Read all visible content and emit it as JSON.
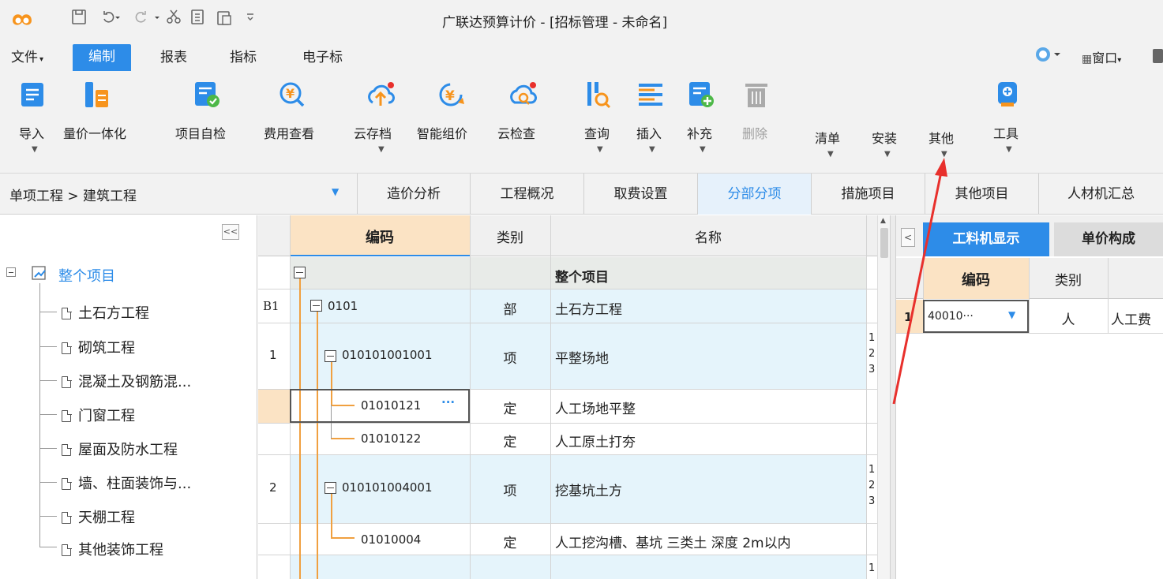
{
  "title": "广联达预算计价 - [招标管理 - 未命名]",
  "menu": {
    "file": "文件",
    "tabs": [
      "编制",
      "报表",
      "指标",
      "电子标"
    ],
    "window_label": "窗口"
  },
  "ribbon": {
    "buttons": [
      "导入",
      "量价一体化",
      "项目自检",
      "费用查看",
      "云存档",
      "智能组价",
      "云检查",
      "查询",
      "插入",
      "补充",
      "删除",
      "清单",
      "安装",
      "其他",
      "工具"
    ]
  },
  "nav": {
    "breadcrumb": "单项工程 > 建筑工程",
    "tabs": [
      "造价分析",
      "工程概况",
      "取费设置",
      "分部分项",
      "措施项目",
      "其他项目",
      "人材机汇总"
    ],
    "active_tab": "分部分项"
  },
  "tree": {
    "collapse_glyph": "<<",
    "root": "整个项目",
    "items": [
      "土石方工程",
      "砌筑工程",
      "混凝土及钢筋混...",
      "门窗工程",
      "屋面及防水工程",
      "墙、柱面装饰与...",
      "天棚工程",
      "其他装饰工程"
    ]
  },
  "table": {
    "headers": {
      "code": "编码",
      "type": "类别",
      "name": "名称"
    },
    "rows": [
      {
        "num": "",
        "code": "",
        "type": "",
        "name": "整个项目",
        "extra": ""
      },
      {
        "num": "B1",
        "code": "0101",
        "type": "部",
        "name": "土石方工程",
        "extra": ""
      },
      {
        "num": "1",
        "code": "010101001001",
        "type": "项",
        "name": "平整场地",
        "extra": "1\n2\n3"
      },
      {
        "num": "",
        "code": "01010121",
        "type": "定",
        "name": "人工场地平整",
        "extra": ""
      },
      {
        "num": "",
        "code": "01010122",
        "type": "定",
        "name": "人工原土打夯",
        "extra": ""
      },
      {
        "num": "2",
        "code": "010101004001",
        "type": "项",
        "name": "挖基坑土方",
        "extra": "1\n2\n3"
      },
      {
        "num": "",
        "code": "01010004",
        "type": "定",
        "name": "人工挖沟槽、基坑 三类土 深度 2m以内",
        "extra": ""
      },
      {
        "num": "",
        "code": "",
        "type": "",
        "name": "",
        "extra": "1"
      }
    ],
    "ellipsis": "···"
  },
  "right": {
    "collapse_glyph": "<",
    "tabs": [
      "工料机显示",
      "单价构成"
    ],
    "headers": {
      "code": "编码",
      "type": "类别"
    },
    "row": {
      "num": "1",
      "code": "40010···",
      "type": "人",
      "name": "人工费"
    }
  },
  "colors": {
    "accent": "#2d8ce8",
    "header_orange": "#fbe3c4",
    "row_blue": "#e5f4fb",
    "row_gray": "#e8ebe8",
    "arrow": "#e8302c"
  }
}
